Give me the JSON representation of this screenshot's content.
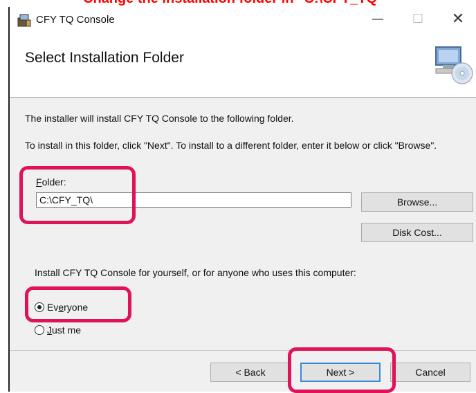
{
  "banner": {
    "text": "Change the installation folder in \"C:\\CFY_TQ\""
  },
  "window": {
    "title": "CFY TQ Console",
    "app_icon": "installer-icon",
    "minimize_glyph": "—",
    "maximize_glyph": "☐",
    "close_glyph": "✕"
  },
  "header": {
    "title": "Select Installation Folder",
    "icon": "computer-cd-icon"
  },
  "body": {
    "line1": "The installer will install CFY TQ Console to the following folder.",
    "line2": "To install in this folder, click \"Next\". To install to a different folder, enter it below or click \"Browse\".",
    "folder_label_accel": "F",
    "folder_label_rest": "older:",
    "folder_value": "C:\\CFY_TQ\\",
    "browse_label": "Browse...",
    "disk_cost_label": "Disk Cost...",
    "install_for_text": "Install CFY TQ Console for yourself, or for anyone who uses this computer:",
    "radio_everyone_pre": "Ev",
    "radio_everyone_accel": "e",
    "radio_everyone_post": "ryone",
    "radio_justme_accel": "J",
    "radio_justme_rest": "ust me",
    "selected": "Everyone"
  },
  "footer": {
    "back_label": "< Back",
    "next_label": "Next >",
    "cancel_label": "Cancel"
  },
  "colors": {
    "highlight": "#e0125b",
    "banner_text": "#ff0000",
    "focus": "#3c8ad6"
  }
}
